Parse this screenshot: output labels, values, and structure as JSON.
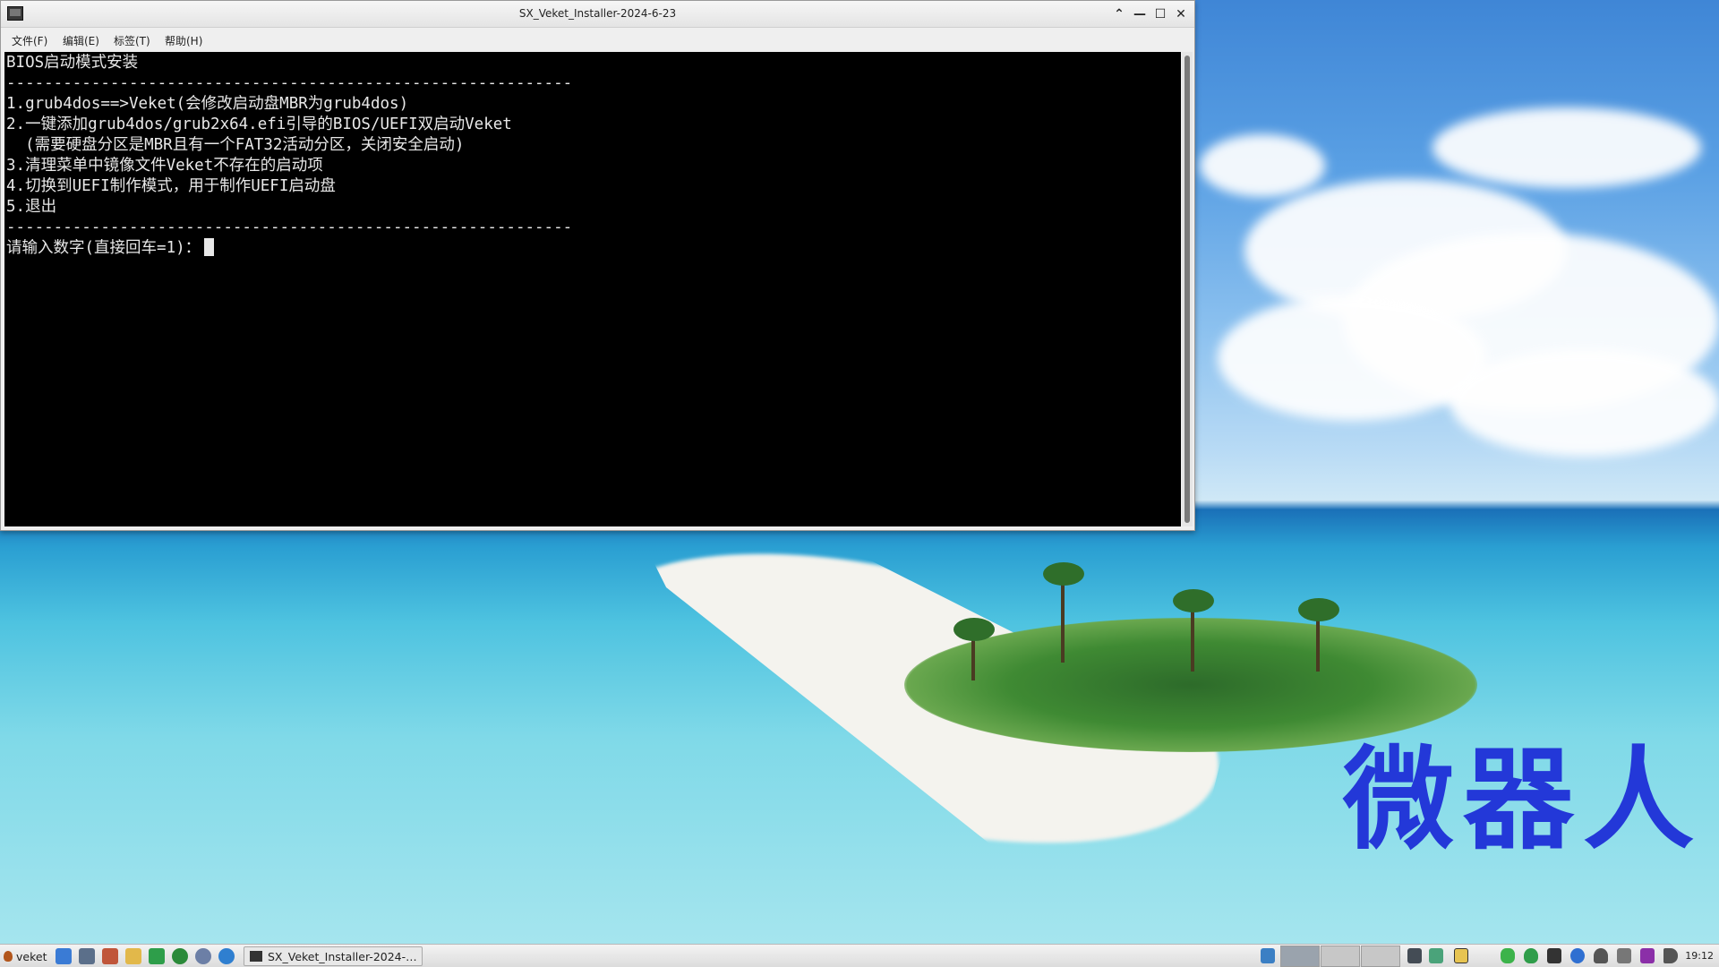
{
  "window": {
    "title": "SX_Veket_Installer-2024-6-23",
    "controls": {
      "up": "⌃",
      "minimize": "—",
      "maximize": "☐",
      "close": "✕"
    }
  },
  "menu": [
    "文件(F)",
    "编辑(E)",
    "标签(T)",
    "帮助(H)"
  ],
  "terminal": {
    "lines": [
      "BIOS启动模式安装",
      "------------------------------------------------------------",
      "1.grub4dos==>Veket(会修改启动盘MBR为grub4dos)",
      "2.一键添加grub4dos/grub2x64.efi引导的BIOS/UEFI双启动Veket",
      "  (需要硬盘分区是MBR且有一个FAT32活动分区，关闭安全启动)",
      "3.清理菜单中镜像文件Veket不存在的启动项",
      "4.切换到UEFI制作模式，用于制作UEFI启动盘",
      "5.退出",
      "------------------------------------------------------------"
    ],
    "prompt": "请输入数字(直接回车=1)："
  },
  "watermark": "微器人",
  "taskbar": {
    "start_label": "veket",
    "task_label": "SX_Veket_Installer-2024-…",
    "clock": "19:12"
  },
  "colors": {
    "terminal_bg": "#000000",
    "terminal_fg": "#e8e8e8",
    "watermark": "#2338d8"
  }
}
